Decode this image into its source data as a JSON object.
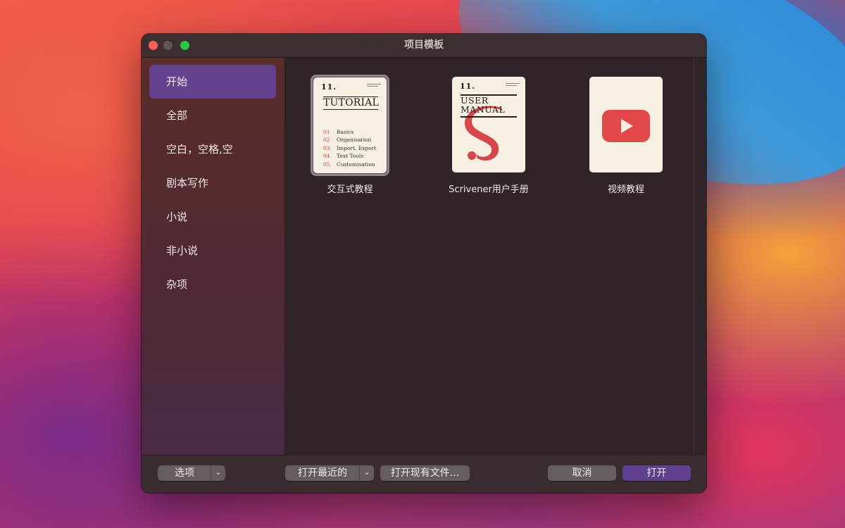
{
  "window": {
    "title": "项目模板"
  },
  "sidebar": {
    "items": [
      {
        "label": "开始",
        "selected": true
      },
      {
        "label": "全部"
      },
      {
        "label": "空白，空格,空"
      },
      {
        "label": "剧本写作"
      },
      {
        "label": "小说"
      },
      {
        "label": "非小说"
      },
      {
        "label": "杂项"
      }
    ]
  },
  "templates": [
    {
      "caption": "交互式教程",
      "selected": true,
      "thumb": {
        "logo": "11.",
        "heading": "TUTORIAL",
        "toc": [
          {
            "num": "01",
            "text": "Basics"
          },
          {
            "num": "02",
            "text": "Organisation"
          },
          {
            "num": "03",
            "text": "Import, Export"
          },
          {
            "num": "04",
            "text": "Text Tools"
          },
          {
            "num": "05",
            "text": "Customisation"
          }
        ]
      }
    },
    {
      "caption": "Scrivener用户手册",
      "thumb": {
        "logo": "11.",
        "heading_line1": "USER",
        "heading_line2": "MANUAL",
        "accent_color": "#d9464a"
      }
    },
    {
      "caption": "视频教程",
      "thumb": {
        "icon": "play-video-icon",
        "accent_color": "#e2484a"
      }
    }
  ],
  "footer": {
    "options_label": "选项",
    "open_recent_label": "打开最近的",
    "open_existing_label": "打开现有文件...",
    "cancel_label": "取消",
    "open_label": "打开"
  },
  "colors": {
    "accent": "#65428e",
    "primary_button": "#5f3f8f",
    "close": "#ff5f57",
    "zoom": "#28c840"
  }
}
